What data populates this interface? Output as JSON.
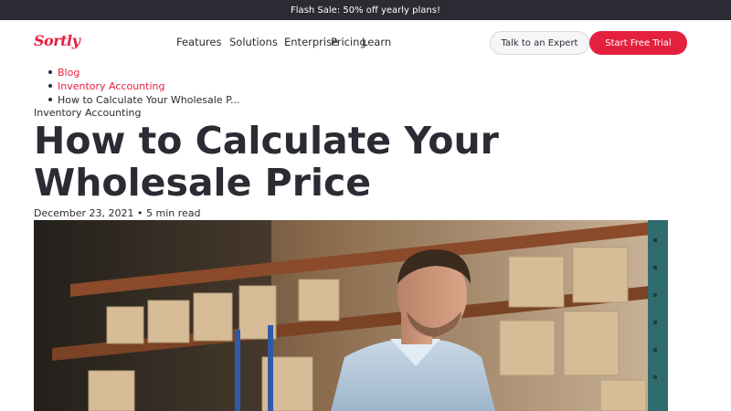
{
  "promo": {
    "text": "Flash Sale: 50% off yearly plans!"
  },
  "brand": {
    "logo_text": "Sortly",
    "accent": "#e3213f"
  },
  "nav": {
    "features": "Features",
    "solutions": "Solutions",
    "enterprise": "Enterprise",
    "pricing": "Pricing",
    "learn": "Learn"
  },
  "cta": {
    "talk_expert": "Talk to an Expert",
    "free_trial": "Start Free Trial"
  },
  "breadcrumb": [
    {
      "label": "Blog"
    },
    {
      "label": "Inventory Accounting"
    },
    {
      "label": "How to Calculate Your Wholesale P..."
    }
  ],
  "article": {
    "category": "Inventory Accounting",
    "title": "How to Calculate Your Wholesale Price",
    "meta": "December 23, 2021 • 5 min read"
  }
}
